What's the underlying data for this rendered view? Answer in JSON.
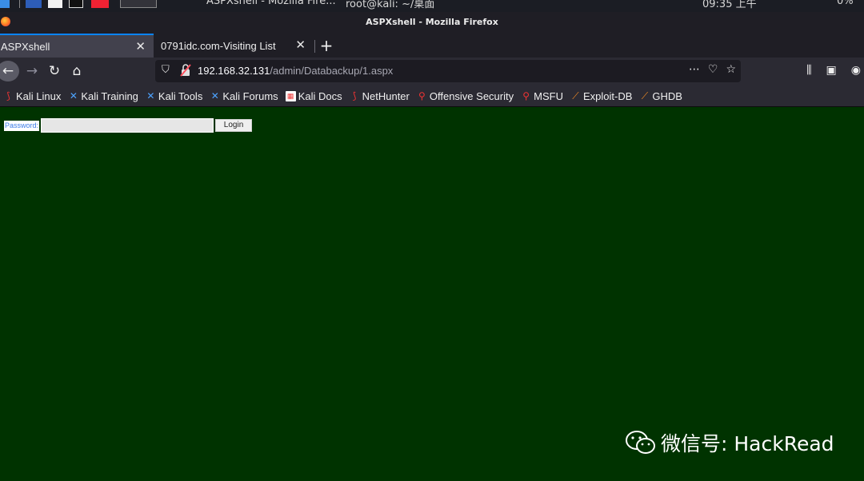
{
  "system_panel": {
    "window_item_1": "ASPXshell - Mozilla Fire...",
    "window_item_2": "root@kali: ~/桌面",
    "clock": "09:35 上午",
    "battery": "0%"
  },
  "window": {
    "title": "ASPXshell - Mozilla Firefox"
  },
  "tabs": [
    {
      "label": "ASPXshell",
      "active": true
    },
    {
      "label": "0791idc.com-Visiting List",
      "active": false
    }
  ],
  "urlbar": {
    "host": "192.168.32.131",
    "path": "/admin/Databackup/1.aspx"
  },
  "bookmarks": [
    {
      "label": "Kali Linux",
      "icon": "kali-dragon-icon"
    },
    {
      "label": "Kali Training",
      "icon": "kali-training-icon"
    },
    {
      "label": "Kali Tools",
      "icon": "kali-tools-icon"
    },
    {
      "label": "Kali Forums",
      "icon": "kali-forums-icon"
    },
    {
      "label": "Kali Docs",
      "icon": "kali-docs-icon"
    },
    {
      "label": "NetHunter",
      "icon": "nethunter-icon"
    },
    {
      "label": "Offensive Security",
      "icon": "offsec-icon"
    },
    {
      "label": "MSFU",
      "icon": "msfu-icon"
    },
    {
      "label": "Exploit-DB",
      "icon": "exploit-db-icon"
    },
    {
      "label": "GHDB",
      "icon": "ghdb-icon"
    }
  ],
  "page": {
    "password_label": "Password:",
    "password_value": "",
    "login_label": "Login"
  },
  "watermark": {
    "text": "微信号: HackRead"
  },
  "colors": {
    "page_background": "#003300",
    "tab_accent": "#0a84ff",
    "label_text": "#3b7be8"
  }
}
